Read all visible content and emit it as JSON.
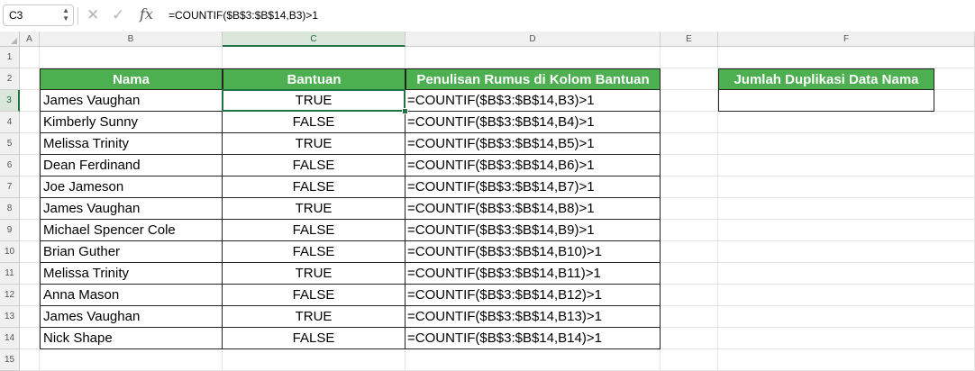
{
  "formula_bar": {
    "name_box": "C3",
    "formula": "=COUNTIF($B$3:$B$14,B3)>1",
    "fx_label": "fx",
    "cancel_glyph": "✕",
    "enter_glyph": "✓"
  },
  "columns": [
    "A",
    "B",
    "C",
    "D",
    "E",
    "F"
  ],
  "rows": [
    "1",
    "2",
    "3",
    "4",
    "5",
    "6",
    "7",
    "8",
    "9",
    "10",
    "11",
    "12",
    "13",
    "14",
    "15"
  ],
  "selected_cell": {
    "column": "C",
    "row": "3"
  },
  "table": {
    "headers": [
      "Nama",
      "Bantuan",
      "Penulisan Rumus di Kolom Bantuan"
    ],
    "rows": [
      {
        "name": "James Vaughan",
        "flag": "TRUE",
        "formula": "=COUNTIF($B$3:$B$14,B3)>1"
      },
      {
        "name": "Kimberly Sunny",
        "flag": "FALSE",
        "formula": "=COUNTIF($B$3:$B$14,B4)>1"
      },
      {
        "name": "Melissa Trinity",
        "flag": "TRUE",
        "formula": "=COUNTIF($B$3:$B$14,B5)>1"
      },
      {
        "name": "Dean Ferdinand",
        "flag": "FALSE",
        "formula": "=COUNTIF($B$3:$B$14,B6)>1"
      },
      {
        "name": "Joe Jameson",
        "flag": "FALSE",
        "formula": "=COUNTIF($B$3:$B$14,B7)>1"
      },
      {
        "name": "James Vaughan",
        "flag": "TRUE",
        "formula": "=COUNTIF($B$3:$B$14,B8)>1"
      },
      {
        "name": "Michael Spencer Cole",
        "flag": "FALSE",
        "formula": "=COUNTIF($B$3:$B$14,B9)>1"
      },
      {
        "name": "Brian Guther",
        "flag": "FALSE",
        "formula": "=COUNTIF($B$3:$B$14,B10)>1"
      },
      {
        "name": "Melissa Trinity",
        "flag": "TRUE",
        "formula": "=COUNTIF($B$3:$B$14,B11)>1"
      },
      {
        "name": "Anna Mason",
        "flag": "FALSE",
        "formula": "=COUNTIF($B$3:$B$14,B12)>1"
      },
      {
        "name": "James Vaughan",
        "flag": "TRUE",
        "formula": "=COUNTIF($B$3:$B$14,B13)>1"
      },
      {
        "name": "Nick Shape",
        "flag": "FALSE",
        "formula": "=COUNTIF($B$3:$B$14,B14)>1"
      }
    ]
  },
  "summary": {
    "header": "Jumlah Duplikasi Data Nama",
    "value": ""
  },
  "colors": {
    "header_fill": "#4caf50",
    "selection_accent": "#217346"
  }
}
